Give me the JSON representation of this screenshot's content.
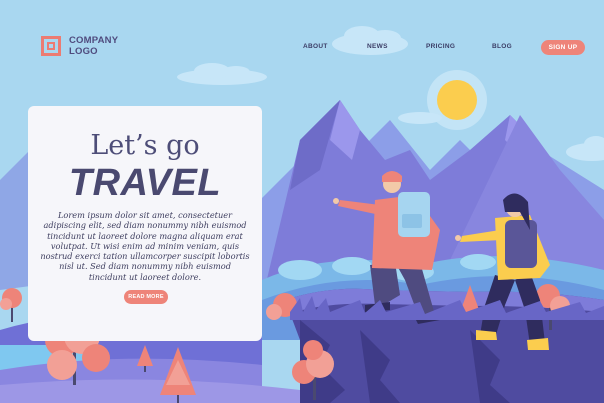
{
  "header": {
    "logo_line1": "COMPANY",
    "logo_line2": "LOGO",
    "nav": [
      {
        "label": "ABOUT"
      },
      {
        "label": "NEWS"
      },
      {
        "label": "PRICING"
      },
      {
        "label": "BLOG"
      }
    ],
    "signup_label": "SIGN UP"
  },
  "hero": {
    "eyebrow": "Let’s go",
    "title": "TRAVEL",
    "body": "Lorem ipsum dolor sit amet, consectetuer adipiscing elit, sed diam nonummy nibh euismod tincidunt ut laoreet dolore magna aliquam erat volutpat. Ut wisi enim ad minim veniam, quis nostrud exerci tation ullamcorper suscipit lobortis nisl ut. Sed diam nonummy nibh euismod tincidunt ut laoreet dolore.",
    "read_more_label": "READ MORE"
  },
  "colors": {
    "sky": "#a9d7f0",
    "accent": "#ee8479",
    "mountain": "#7f7ed8",
    "sun": "#fbcd4e",
    "text": "#4a4970"
  },
  "icons": [
    "logo-mark-icon",
    "sun-icon",
    "cloud-icon",
    "tree-icon"
  ]
}
